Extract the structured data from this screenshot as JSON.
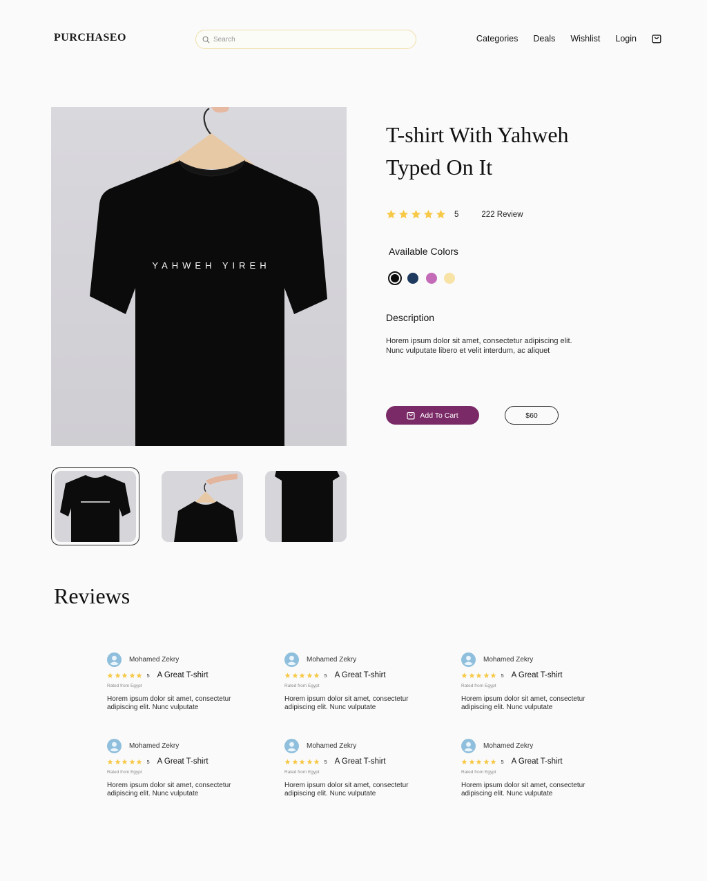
{
  "header": {
    "logo": "PURCHASEO",
    "search_placeholder": "Search",
    "nav": [
      "Categories",
      "Deals",
      "Wishlist",
      "Login"
    ]
  },
  "product": {
    "title": "T-shirt With Yahweh Typed On It",
    "shirt_print": "YAHWEH YIREH",
    "rating": "5",
    "review_count": "222 Review",
    "stars": 5,
    "colors_label": "Available Colors",
    "colors": [
      "#0a0a0a",
      "#1f3a5f",
      "#c46bb8",
      "#f8e3a6"
    ],
    "selected_color_index": 0,
    "description_label": "Description",
    "description": "Horem ipsum dolor sit amet, consectetur adipiscing elit. Nunc vulputate libero et velit interdum, ac aliquet",
    "add_to_cart": "Add To Cart",
    "price": "$60",
    "accent": "#7a2a66",
    "star_color": "#f7c948"
  },
  "reviews": {
    "heading": "Reviews",
    "items": [
      {
        "name": "Mohamed Zekry",
        "score": "5",
        "title": "A Great T-shirt",
        "origin": "Rated from Egypt",
        "body": "Horem ipsum dolor sit amet, consectetur adipiscing elit. Nunc vulputate"
      },
      {
        "name": "Mohamed Zekry",
        "score": "5",
        "title": "A Great T-shirt",
        "origin": "Rated from Egypt",
        "body": "Horem ipsum dolor sit amet, consectetur adipiscing elit. Nunc vulputate"
      },
      {
        "name": "Mohamed Zekry",
        "score": "5",
        "title": "A Great T-shirt",
        "origin": "Rated from Egypt",
        "body": "Horem ipsum dolor sit amet, consectetur adipiscing elit. Nunc vulputate"
      },
      {
        "name": "Mohamed Zekry",
        "score": "5",
        "title": "A Great T-shirt",
        "origin": "Rated from Egypt",
        "body": "Horem ipsum dolor sit amet, consectetur adipiscing elit. Nunc vulputate"
      },
      {
        "name": "Mohamed Zekry",
        "score": "5",
        "title": "A Great T-shirt",
        "origin": "Rated from Egypt",
        "body": "Horem ipsum dolor sit amet, consectetur adipiscing elit. Nunc vulputate"
      },
      {
        "name": "Mohamed Zekry",
        "score": "5",
        "title": "A Great T-shirt",
        "origin": "Rated from Egypt",
        "body": "Horem ipsum dolor sit amet, consectetur adipiscing elit. Nunc vulputate"
      }
    ]
  },
  "icons": {
    "search": "search-icon",
    "cart": "shopping-bag-icon",
    "star": "star-icon",
    "avatar": "user-avatar-icon"
  }
}
